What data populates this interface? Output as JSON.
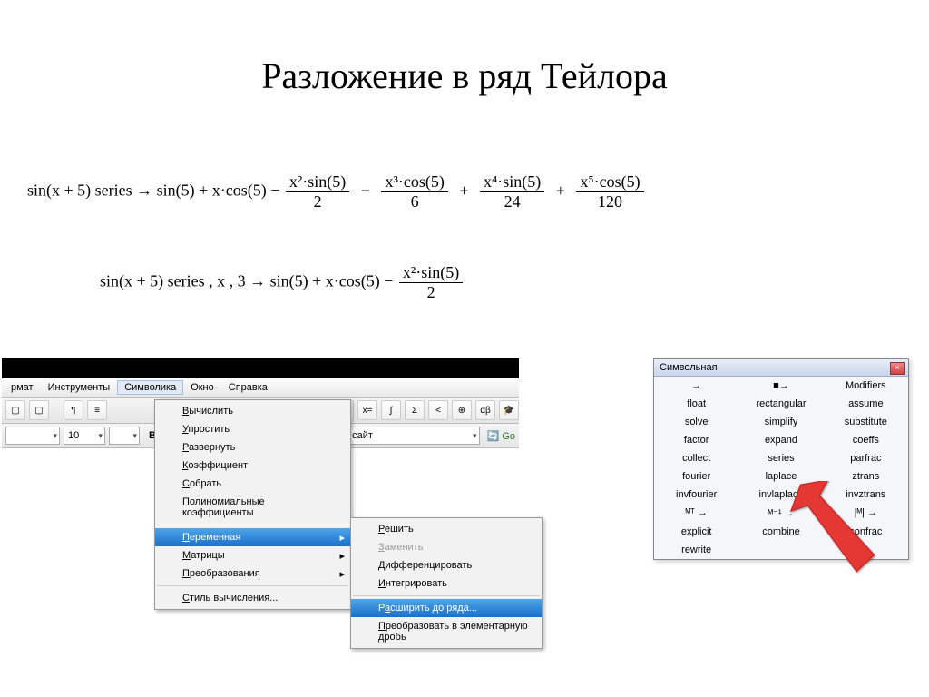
{
  "title": "Разложение в ряд Тейлора",
  "formulas": {
    "f1_left": "sin(x + 5)  series  →  sin(5) + x·cos(5)  − ",
    "f1_t2_num": "x²·sin(5)",
    "f1_t2_den": "2",
    "f1_t3_num": "x³·cos(5)",
    "f1_t3_den": "6",
    "f1_t4_num": "x⁴·sin(5)",
    "f1_t4_den": "24",
    "f1_t5_num": "x⁵·cos(5)",
    "f1_t5_den": "120",
    "f2_left": "sin(x + 5)  series , x , 3  →  sin(5) + x·cos(5)  − ",
    "f2_t2_num": "x²·sin(5)",
    "f2_t2_den": "2"
  },
  "menubar": {
    "items": [
      "рмат",
      "Инструменты",
      "Символика",
      "Окно",
      "Справка"
    ],
    "active_index": 2
  },
  "toolbar": {
    "font_size": "10",
    "bold": "B",
    "site_combo": "Мой сайт",
    "go": "Go"
  },
  "dropdown": {
    "items": [
      {
        "label": "Вычислить",
        "u": 0
      },
      {
        "label": "Упростить",
        "u": 0
      },
      {
        "label": "Развернуть",
        "u": 0
      },
      {
        "label": "Коэффициент",
        "u": 0
      },
      {
        "label": "Собрать",
        "u": 0
      },
      {
        "label": "Полиномиальные коэффициенты",
        "u": 0
      }
    ],
    "sub_items": [
      {
        "label": "Переменная",
        "u": 0,
        "hl": true,
        "arrow": true
      },
      {
        "label": "Матрицы",
        "u": 0,
        "arrow": true
      },
      {
        "label": "Преобразования",
        "u": 0,
        "arrow": true
      }
    ],
    "last": {
      "label": "Стиль вычисления...",
      "u": 0
    }
  },
  "submenu": {
    "items": [
      {
        "label": "Решить",
        "u": 0
      },
      {
        "label": "Заменить",
        "u": 0,
        "disabled": true
      },
      {
        "label": "Дифференцировать",
        "u": 0
      },
      {
        "label": "Интегрировать",
        "u": 0
      }
    ],
    "hl": {
      "label": "Расширить до ряда...",
      "u": 0
    },
    "last": {
      "label": "Преобразовать в элементарную дробь",
      "u": 0
    }
  },
  "palette": {
    "title": "Символьная",
    "rows": [
      [
        "→",
        "■→",
        "Modifiers"
      ],
      [
        "float",
        "rectangular",
        "assume"
      ],
      [
        "solve",
        "simplify",
        "substitute"
      ],
      [
        "factor",
        "expand",
        "coeffs"
      ],
      [
        "collect",
        "series",
        "parfrac"
      ],
      [
        "fourier",
        "laplace",
        "ztrans"
      ],
      [
        "invfourier",
        "invlaplace",
        "invztrans"
      ],
      [
        "ᴹᵀ →",
        "ᴹ⁻¹ →",
        "|ᴹ| →"
      ],
      [
        "explicit",
        "combine",
        "confrac"
      ],
      [
        "rewrite",
        "",
        ""
      ]
    ]
  }
}
